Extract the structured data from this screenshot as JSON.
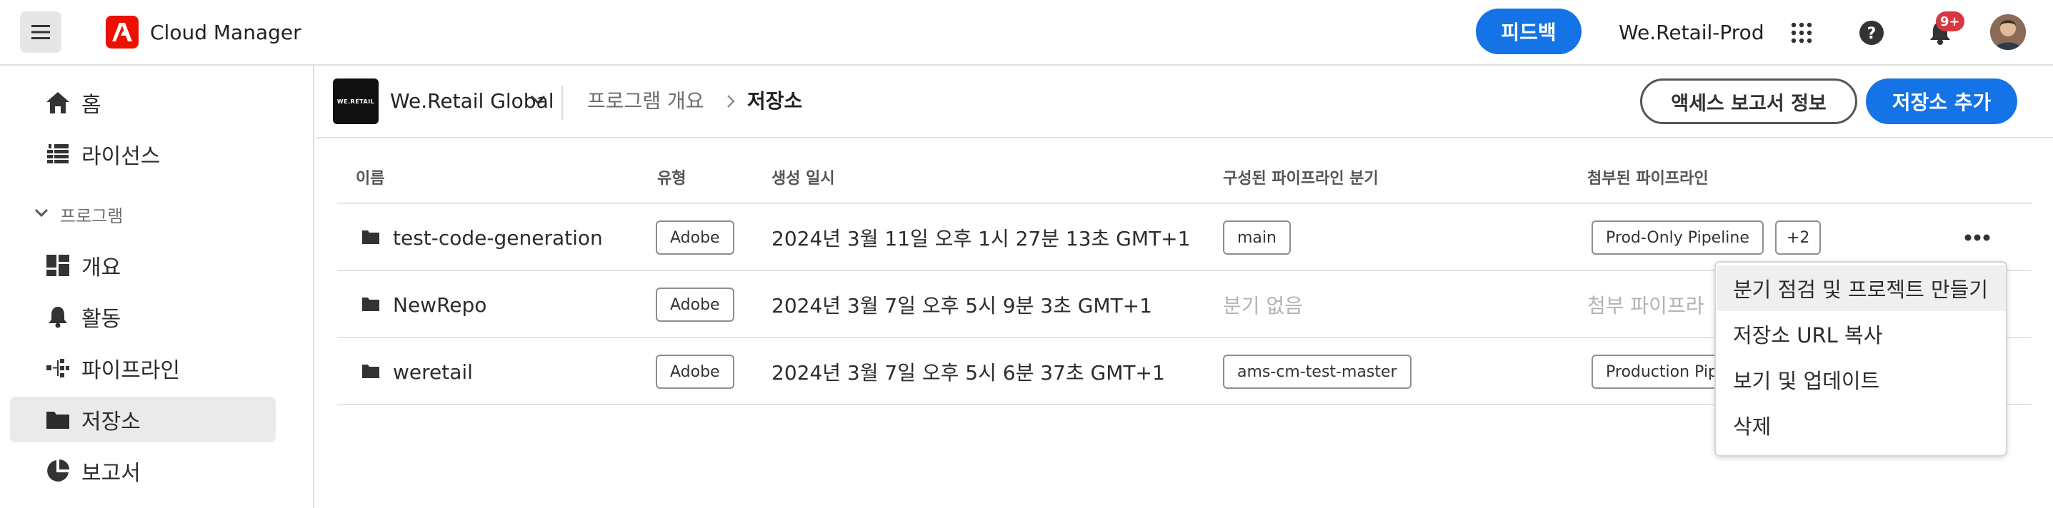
{
  "header": {
    "app_title": "Cloud Manager",
    "feedback_label": "피드백",
    "org_name": "We.Retail-Prod",
    "notification_count": "9+",
    "icons": [
      "menu-icon",
      "adobe-logo",
      "apps-grid-icon",
      "help-icon",
      "bell-icon",
      "user-avatar"
    ]
  },
  "sidebar": {
    "items": [
      {
        "label": "홈",
        "icon": "home-icon"
      },
      {
        "label": "라이선스",
        "icon": "license-icon"
      }
    ],
    "section_label": "프로그램",
    "program_items": [
      {
        "label": "개요",
        "icon": "dashboard-icon"
      },
      {
        "label": "활동",
        "icon": "bell-icon"
      },
      {
        "label": "파이프라인",
        "icon": "pipeline-icon"
      },
      {
        "label": "저장소",
        "icon": "folder-icon",
        "active": true
      },
      {
        "label": "보고서",
        "icon": "pie-chart-icon"
      }
    ]
  },
  "subheader": {
    "program_thumb_text": "WE.RETAIL",
    "program_name": "We.Retail Global",
    "breadcrumb_parent": "프로그램 개요",
    "breadcrumb_current": "저장소",
    "access_report_label": "액세스 보고서 정보",
    "add_repo_label": "저장소 추가"
  },
  "table": {
    "columns": [
      "이름",
      "유형",
      "생성 일시",
      "구성된 파이프라인 분기",
      "첨부된 파이프라인"
    ],
    "rows": [
      {
        "name": "test-code-generation",
        "type": "Adobe",
        "created": "2024년 3월 11일 오후 1시 27분 13초 GMT+1",
        "branch": "main",
        "pipeline": "Prod-Only Pipeline",
        "pipeline_extra": "+2"
      },
      {
        "name": "NewRepo",
        "type": "Adobe",
        "created": "2024년 3월 7일 오후 5시 9분 3초 GMT+1",
        "branch_empty": "분기 없음",
        "pipeline_empty": "첨부 파이프라"
      },
      {
        "name": "weretail",
        "type": "Adobe",
        "created": "2024년 3월 7일 오후 5시 6분 37초 GMT+1",
        "branch": "ams-cm-test-master",
        "pipeline": "Production Pipe"
      }
    ]
  },
  "context_menu": {
    "items": [
      "분기 점검 및 프로젝트 만들기",
      "저장소 URL 복사",
      "보기 및 업데이트",
      "삭제"
    ]
  },
  "colors": {
    "accent": "#1473e6",
    "adobe_red": "#eb1000",
    "badge": "#d7373f"
  }
}
